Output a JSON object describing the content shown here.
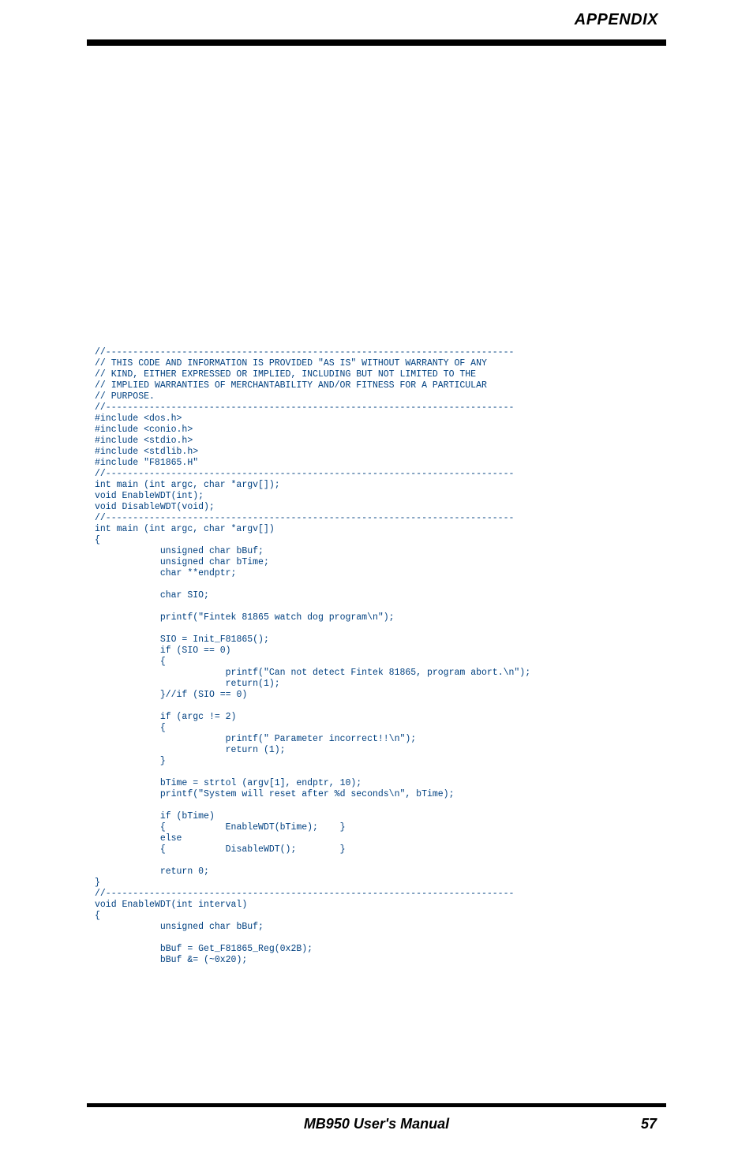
{
  "header": {
    "title": "APPENDIX"
  },
  "code": {
    "text": "//---------------------------------------------------------------------------\n// THIS CODE AND INFORMATION IS PROVIDED \"AS IS\" WITHOUT WARRANTY OF ANY\n// KIND, EITHER EXPRESSED OR IMPLIED, INCLUDING BUT NOT LIMITED TO THE\n// IMPLIED WARRANTIES OF MERCHANTABILITY AND/OR FITNESS FOR A PARTICULAR\n// PURPOSE.\n//---------------------------------------------------------------------------\n#include <dos.h>\n#include <conio.h>\n#include <stdio.h>\n#include <stdlib.h>\n#include \"F81865.H\"\n//---------------------------------------------------------------------------\nint main (int argc, char *argv[]);\nvoid EnableWDT(int);\nvoid DisableWDT(void);\n//---------------------------------------------------------------------------\nint main (int argc, char *argv[])\n{\n            unsigned char bBuf;\n            unsigned char bTime;\n            char **endptr;\n\n            char SIO;\n\n            printf(\"Fintek 81865 watch dog program\\n\");\n\n            SIO = Init_F81865();\n            if (SIO == 0)\n            {\n                        printf(\"Can not detect Fintek 81865, program abort.\\n\");\n                        return(1);\n            }//if (SIO == 0)\n\n            if (argc != 2)\n            {\n                        printf(\" Parameter incorrect!!\\n\");\n                        return (1);\n            }\n\n            bTime = strtol (argv[1], endptr, 10);\n            printf(\"System will reset after %d seconds\\n\", bTime);\n\n            if (bTime)\n            {           EnableWDT(bTime);    }\n            else\n            {           DisableWDT();        }\n\n            return 0;\n}\n//---------------------------------------------------------------------------\nvoid EnableWDT(int interval)\n{\n            unsigned char bBuf;\n\n            bBuf = Get_F81865_Reg(0x2B);\n            bBuf &= (~0x20);"
  },
  "footer": {
    "product": "MB950 User's Manual",
    "page": "57"
  }
}
